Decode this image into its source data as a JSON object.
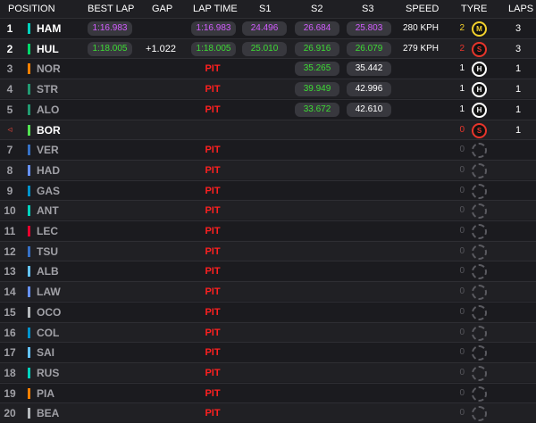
{
  "headers": {
    "position": "POSITION",
    "best_lap": "BEST LAP",
    "gap": "GAP",
    "lap_time": "LAP TIME",
    "s1": "S1",
    "s2": "S2",
    "s3": "S3",
    "speed": "SPEED",
    "tyre": "TYRE",
    "laps": "LAPS"
  },
  "colors": {
    "personal_best": "#3ddc34",
    "overall_best": "#d25cff",
    "pit": "#ff2020",
    "tyre_soft": "#e8352b",
    "tyre_medium": "#f3d12c",
    "tyre_hard": "#ffffff"
  },
  "rows": [
    {
      "pos": "1",
      "driver": "HAM",
      "team_color": "#00d2be",
      "best_lap": "1:16.983",
      "best_lap_color": "purple",
      "gap": "",
      "lap_time": "1:16.983",
      "lap_time_color": "purple",
      "s1": "24.496",
      "s1_color": "purple",
      "s2": "26.684",
      "s2_color": "purple",
      "s3": "25.803",
      "s3_color": "purple",
      "speed": "280 KPH",
      "tyre_count": "2",
      "tyre": "M",
      "tyre_type": "medium",
      "tyre_icon": "tyre-medium-icon",
      "laps": "3"
    },
    {
      "pos": "2",
      "driver": "HUL",
      "team_color": "#00d86a",
      "best_lap": "1:18.005",
      "best_lap_color": "green",
      "gap": "+1.022",
      "lap_time": "1:18.005",
      "lap_time_color": "green",
      "s1": "25.010",
      "s1_color": "green",
      "s2": "26.916",
      "s2_color": "green",
      "s3": "26.079",
      "s3_color": "green",
      "speed": "279 KPH",
      "tyre_count": "2",
      "tyre": "S",
      "tyre_type": "soft",
      "tyre_icon": "tyre-soft-icon",
      "laps": "3"
    },
    {
      "pos": "3",
      "driver": "NOR",
      "team_color": "#ff8000",
      "pit": "PIT",
      "s2": "35.265",
      "s2_color": "green",
      "s3": "35.442",
      "s3_color": "white",
      "tyre_count": "1",
      "tyre": "H",
      "tyre_type": "hard",
      "tyre_icon": "tyre-hard-icon",
      "laps": "1",
      "inpit": true
    },
    {
      "pos": "4",
      "driver": "STR",
      "team_color": "#229971",
      "pit": "PIT",
      "s2": "39.949",
      "s2_color": "green",
      "s3": "42.996",
      "s3_color": "white",
      "tyre_count": "1",
      "tyre": "H",
      "tyre_type": "hard",
      "tyre_icon": "tyre-hard-icon",
      "laps": "1",
      "inpit": true
    },
    {
      "pos": "5",
      "driver": "ALO",
      "team_color": "#229971",
      "pit": "PIT",
      "s2": "33.672",
      "s2_color": "green",
      "s3": "42.610",
      "s3_color": "white",
      "tyre_count": "1",
      "tyre": "H",
      "tyre_type": "hard",
      "tyre_icon": "tyre-hard-icon",
      "laps": "1",
      "inpit": true
    },
    {
      "pos": "◃",
      "driver": "BOR",
      "team_color": "#52e252",
      "tyre_count": "0",
      "tyre": "S",
      "tyre_type": "soft",
      "tyre_icon": "tyre-soft-icon",
      "laps": "1",
      "arrow": true
    },
    {
      "pos": "7",
      "driver": "VER",
      "team_color": "#3671c6",
      "pit": "PIT",
      "tyre_count": "0",
      "tyre_type": "none",
      "tyre_icon": "tyre-unknown-icon",
      "laps": "",
      "inpit": true
    },
    {
      "pos": "8",
      "driver": "HAD",
      "team_color": "#6692ff",
      "pit": "PIT",
      "tyre_count": "0",
      "tyre_type": "none",
      "tyre_icon": "tyre-unknown-icon",
      "laps": "",
      "inpit": true
    },
    {
      "pos": "9",
      "driver": "GAS",
      "team_color": "#0093cc",
      "pit": "PIT",
      "tyre_count": "0",
      "tyre_type": "none",
      "tyre_icon": "tyre-unknown-icon",
      "laps": "",
      "inpit": true
    },
    {
      "pos": "10",
      "driver": "ANT",
      "team_color": "#00d2be",
      "pit": "PIT",
      "tyre_count": "0",
      "tyre_type": "none",
      "tyre_icon": "tyre-unknown-icon",
      "laps": "",
      "inpit": true
    },
    {
      "pos": "11",
      "driver": "LEC",
      "team_color": "#e8002d",
      "pit": "PIT",
      "tyre_count": "0",
      "tyre_type": "none",
      "tyre_icon": "tyre-unknown-icon",
      "laps": "",
      "inpit": true
    },
    {
      "pos": "12",
      "driver": "TSU",
      "team_color": "#3671c6",
      "pit": "PIT",
      "tyre_count": "0",
      "tyre_type": "none",
      "tyre_icon": "tyre-unknown-icon",
      "laps": "",
      "inpit": true
    },
    {
      "pos": "13",
      "driver": "ALB",
      "team_color": "#64c4ff",
      "pit": "PIT",
      "tyre_count": "0",
      "tyre_type": "none",
      "tyre_icon": "tyre-unknown-icon",
      "laps": "",
      "inpit": true
    },
    {
      "pos": "14",
      "driver": "LAW",
      "team_color": "#6692ff",
      "pit": "PIT",
      "tyre_count": "0",
      "tyre_type": "none",
      "tyre_icon": "tyre-unknown-icon",
      "laps": "",
      "inpit": true
    },
    {
      "pos": "15",
      "driver": "OCO",
      "team_color": "#b6babd",
      "pit": "PIT",
      "tyre_count": "0",
      "tyre_type": "none",
      "tyre_icon": "tyre-unknown-icon",
      "laps": "",
      "inpit": true
    },
    {
      "pos": "16",
      "driver": "COL",
      "team_color": "#0093cc",
      "pit": "PIT",
      "tyre_count": "0",
      "tyre_type": "none",
      "tyre_icon": "tyre-unknown-icon",
      "laps": "",
      "inpit": true
    },
    {
      "pos": "17",
      "driver": "SAI",
      "team_color": "#64c4ff",
      "pit": "PIT",
      "tyre_count": "0",
      "tyre_type": "none",
      "tyre_icon": "tyre-unknown-icon",
      "laps": "",
      "inpit": true
    },
    {
      "pos": "18",
      "driver": "RUS",
      "team_color": "#00d2be",
      "pit": "PIT",
      "tyre_count": "0",
      "tyre_type": "none",
      "tyre_icon": "tyre-unknown-icon",
      "laps": "",
      "inpit": true
    },
    {
      "pos": "19",
      "driver": "PIA",
      "team_color": "#ff8000",
      "pit": "PIT",
      "tyre_count": "0",
      "tyre_type": "none",
      "tyre_icon": "tyre-unknown-icon",
      "laps": "",
      "inpit": true
    },
    {
      "pos": "20",
      "driver": "BEA",
      "team_color": "#b6babd",
      "pit": "PIT",
      "tyre_count": "0",
      "tyre_type": "none",
      "tyre_icon": "tyre-unknown-icon",
      "laps": "",
      "inpit": true
    }
  ]
}
